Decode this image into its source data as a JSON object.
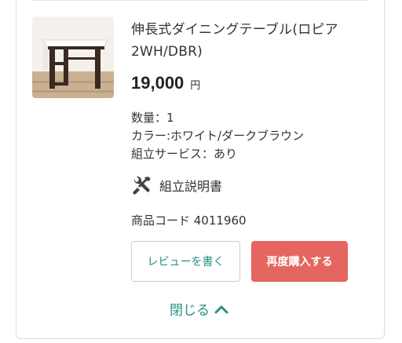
{
  "product": {
    "name": "伸長式ダイニングテーブル(ロピア2WH/DBR)",
    "price": "19,000",
    "currency": "円",
    "quantity": "数量：1",
    "color": "カラー:ホワイト/ダークブラウン",
    "assembly": "組立サービス：あり",
    "manual_label": "組立説明書",
    "code": "商品コード 4011960",
    "image_icon": "dining-table-photo"
  },
  "actions": {
    "review": "レビューを書く",
    "reorder": "再度購入する",
    "close": "閉じる"
  },
  "colors": {
    "accent_teal": "#2a8f86",
    "reorder_red": "#e56660"
  }
}
